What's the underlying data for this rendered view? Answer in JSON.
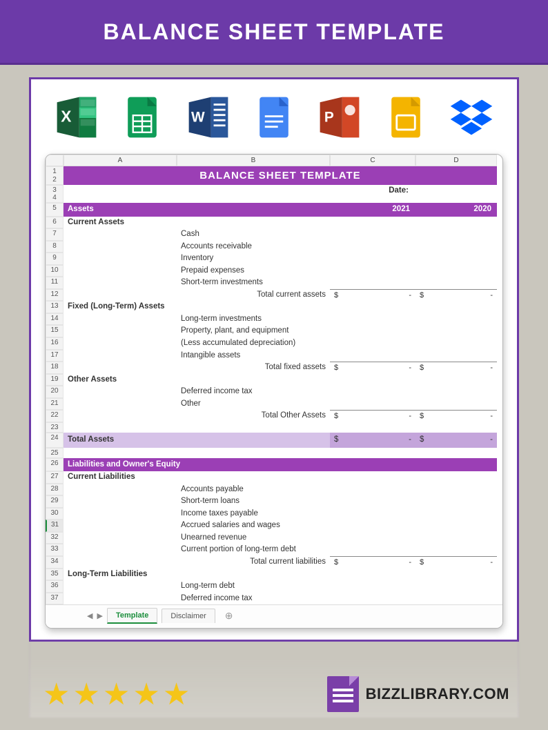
{
  "banner": {
    "title": "BALANCE SHEET TEMPLATE"
  },
  "icons": [
    "excel",
    "sheets",
    "word",
    "docs",
    "powerpoint",
    "slides",
    "dropbox"
  ],
  "spreadsheet": {
    "cols": [
      "A",
      "B",
      "C",
      "D"
    ],
    "title": "BALANCE SHEET TEMPLATE",
    "date_label": "Date:",
    "year1": "2021",
    "year2": "2020",
    "section_assets": "Assets",
    "current_assets": "Current Assets",
    "fixed_assets": "Fixed (Long-Term) Assets",
    "other_assets": "Other Assets",
    "total_assets": "Total Assets",
    "liab_equity": "Liabilities and Owner's Equity",
    "current_liab": "Current Liabilities",
    "longterm_liab": "Long-Term Liabilities",
    "rows_ca": [
      "Cash",
      "Accounts receivable",
      "Inventory",
      "Prepaid expenses",
      "Short-term investments"
    ],
    "total_ca": "Total current assets",
    "rows_fa": [
      "Long-term investments",
      "Property, plant, and equipment",
      "(Less accumulated depreciation)",
      "Intangible assets"
    ],
    "total_fa": "Total fixed assets",
    "rows_oa": [
      "Deferred income tax",
      "Other"
    ],
    "total_oa": "Total Other Assets",
    "rows_cl": [
      "Accounts payable",
      "Short-term loans",
      "Income taxes payable",
      "Accrued salaries and wages",
      "Unearned revenue",
      "Current portion of long-term debt"
    ],
    "total_cl": "Total current liabilities",
    "rows_ll": [
      "Long-term debt",
      "Deferred income tax"
    ],
    "dollar": "$",
    "dash": "-",
    "tabs": {
      "active": "Template",
      "other": "Disclaimer"
    },
    "rownums": [
      "1",
      "2",
      "3",
      "4",
      "5",
      "6",
      "7",
      "8",
      "9",
      "10",
      "11",
      "12",
      "13",
      "14",
      "15",
      "16",
      "17",
      "18",
      "19",
      "20",
      "21",
      "22",
      "23",
      "24",
      "25",
      "26",
      "27",
      "28",
      "29",
      "30",
      "31",
      "32",
      "33",
      "34",
      "35",
      "36",
      "37"
    ]
  },
  "footer": {
    "stars": 5,
    "brand": "BIZZLIBRARY.COM"
  }
}
